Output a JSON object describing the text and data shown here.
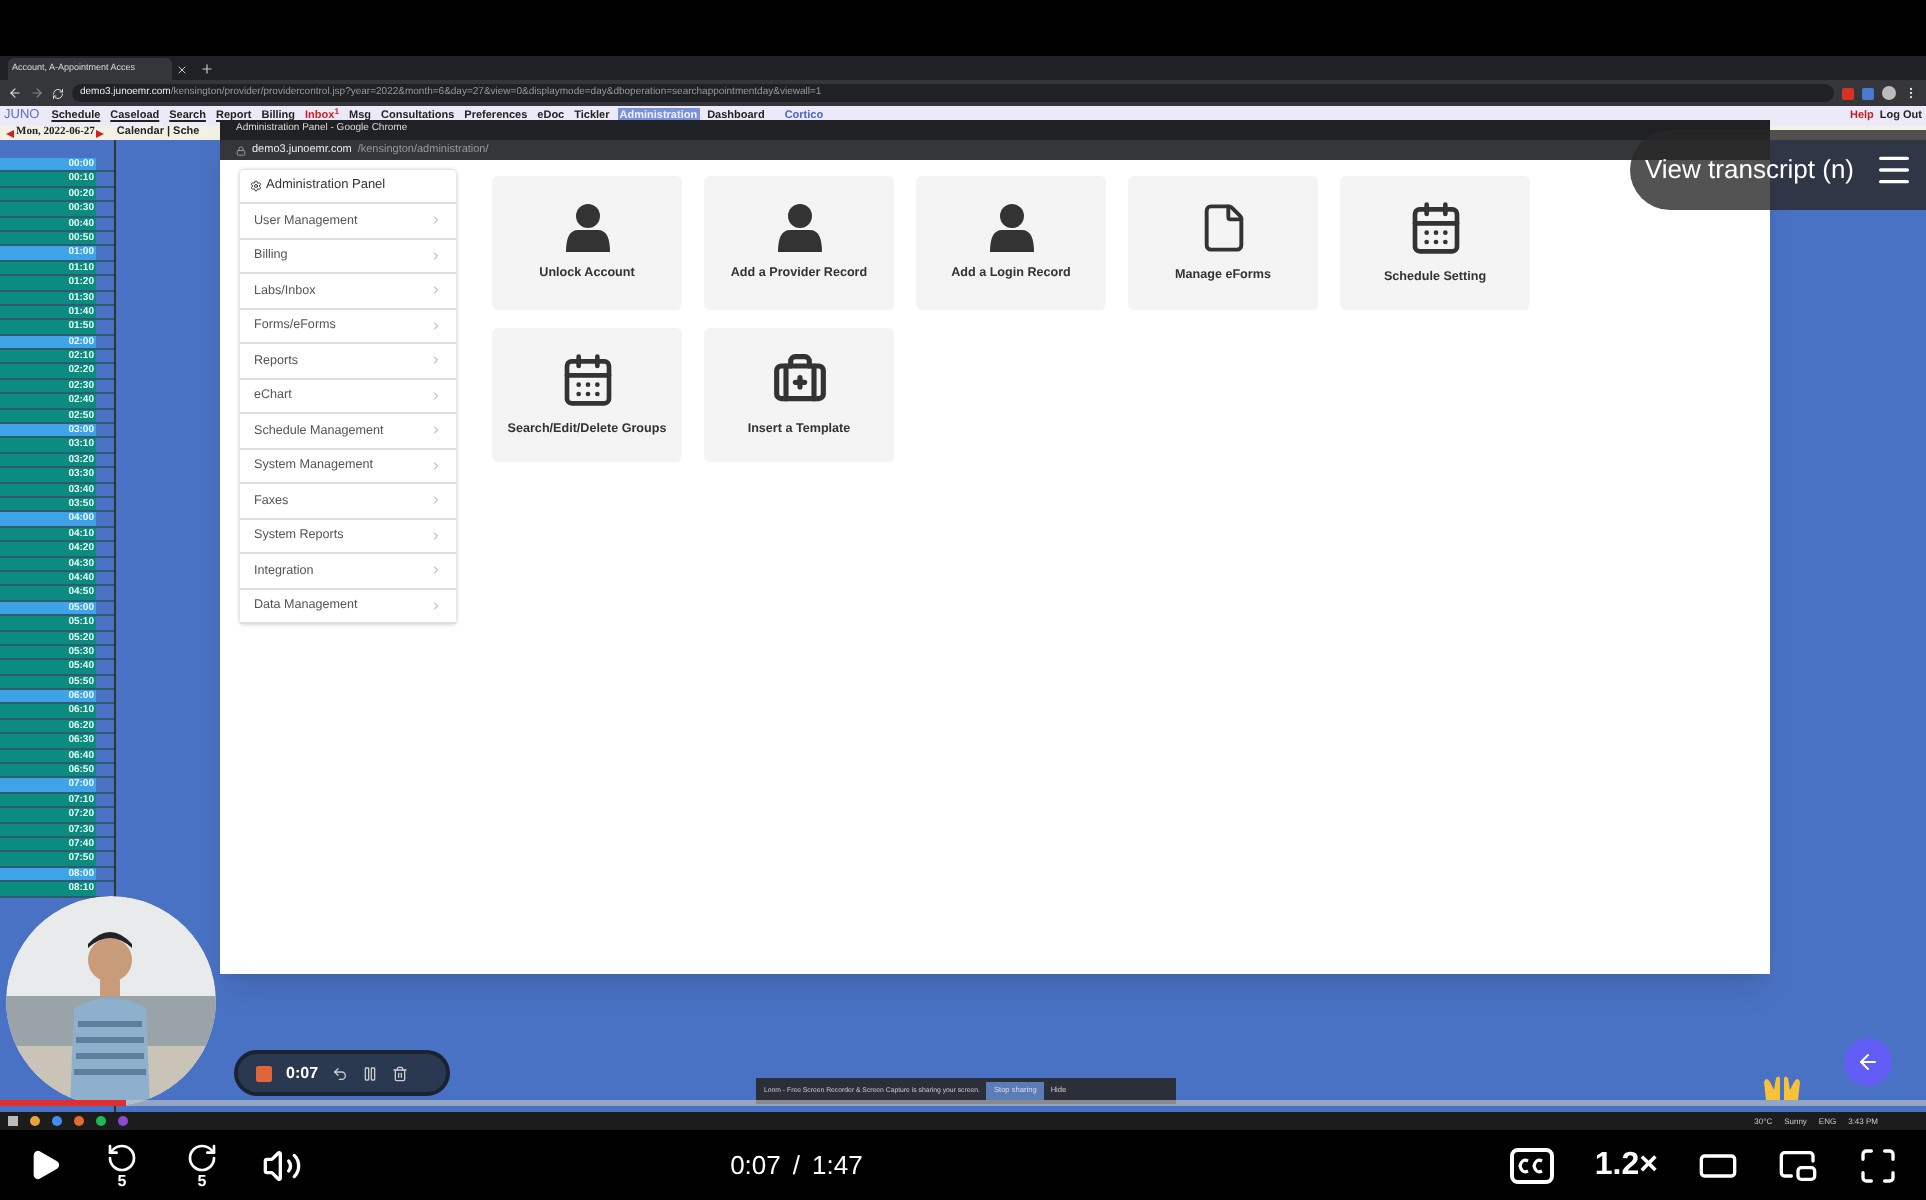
{
  "browser": {
    "tab_title": "Account, A-Appointment Acces",
    "url_host": "demo3.junoemr.com",
    "url_path": "/kensington/provider/providercontrol.jsp?year=2022&month=6&day=27&view=0&displaymode=day&dboperation=searchappointmentday&viewall=1"
  },
  "emr_menu": {
    "logo": "JUNO",
    "items": [
      {
        "label": "Schedule",
        "selected": false
      },
      {
        "label": "Caseload",
        "selected": false
      },
      {
        "label": "Search",
        "selected": false
      },
      {
        "label": "Report",
        "selected": false
      },
      {
        "label": "Billing",
        "selected": false
      },
      {
        "label": "Inbox",
        "selected": false,
        "badge": "1"
      },
      {
        "label": "Msg",
        "selected": false
      },
      {
        "label": "Consultations",
        "selected": false
      },
      {
        "label": "Preferences",
        "selected": false
      },
      {
        "label": "eDoc",
        "selected": false
      },
      {
        "label": "Tickler",
        "selected": false
      },
      {
        "label": "Administration",
        "selected": true
      },
      {
        "label": "Dashboard",
        "selected": false
      }
    ],
    "extension": "Cortico",
    "help": "Help",
    "logout": "Log Out"
  },
  "date_row": {
    "date": "Mon, 2022-06-27",
    "links": "Calendar | Sche"
  },
  "time_slots": [
    {
      "time": "00:00",
      "hour": true
    },
    {
      "time": "00:10",
      "hour": false
    },
    {
      "time": "00:20",
      "hour": false
    },
    {
      "time": "00:30",
      "hour": false
    },
    {
      "time": "00:40",
      "hour": false
    },
    {
      "time": "00:50",
      "hour": false
    },
    {
      "time": "01:00",
      "hour": true
    },
    {
      "time": "01:10",
      "hour": false
    },
    {
      "time": "01:20",
      "hour": false
    },
    {
      "time": "01:30",
      "hour": false
    },
    {
      "time": "01:40",
      "hour": false
    },
    {
      "time": "01:50",
      "hour": false
    },
    {
      "time": "02:00",
      "hour": true
    },
    {
      "time": "02:10",
      "hour": false
    },
    {
      "time": "02:20",
      "hour": false
    },
    {
      "time": "02:30",
      "hour": false
    },
    {
      "time": "02:40",
      "hour": false
    },
    {
      "time": "02:50",
      "hour": false
    },
    {
      "time": "03:00",
      "hour": true
    },
    {
      "time": "03:10",
      "hour": false
    },
    {
      "time": "03:20",
      "hour": false
    },
    {
      "time": "03:30",
      "hour": false
    },
    {
      "time": "03:40",
      "hour": false
    },
    {
      "time": "03:50",
      "hour": false
    },
    {
      "time": "04:00",
      "hour": true
    },
    {
      "time": "04:10",
      "hour": false
    },
    {
      "time": "04:20",
      "hour": false
    },
    {
      "time": "04:30",
      "hour": false
    },
    {
      "time": "04:40",
      "hour": false
    },
    {
      "time": "04:50",
      "hour": false
    },
    {
      "time": "05:00",
      "hour": true
    },
    {
      "time": "05:10",
      "hour": false
    },
    {
      "time": "05:20",
      "hour": false
    },
    {
      "time": "05:30",
      "hour": false
    },
    {
      "time": "05:40",
      "hour": false
    },
    {
      "time": "05:50",
      "hour": false
    },
    {
      "time": "06:00",
      "hour": true
    },
    {
      "time": "06:10",
      "hour": false
    },
    {
      "time": "06:20",
      "hour": false
    },
    {
      "time": "06:30",
      "hour": false
    },
    {
      "time": "06:40",
      "hour": false
    },
    {
      "time": "06:50",
      "hour": false
    },
    {
      "time": "07:00",
      "hour": true
    },
    {
      "time": "07:10",
      "hour": false
    },
    {
      "time": "07:20",
      "hour": false
    },
    {
      "time": "07:30",
      "hour": false
    },
    {
      "time": "07:40",
      "hour": false
    },
    {
      "time": "07:50",
      "hour": false
    },
    {
      "time": "08:00",
      "hour": true
    },
    {
      "time": "08:10",
      "hour": false
    }
  ],
  "popup": {
    "title": "Administration Panel - Google Chrome",
    "url_host": "demo3.junoemr.com",
    "url_path": "/kensington/administration/",
    "panel_title": "Administration Panel",
    "menu": [
      "User Management",
      "Billing",
      "Labs/Inbox",
      "Forms/eForms",
      "Reports",
      "eChart",
      "Schedule Management",
      "System Management",
      "Faxes",
      "System Reports",
      "Integration",
      "Data Management"
    ],
    "tiles": [
      {
        "label": "Unlock Account",
        "kind": "user"
      },
      {
        "label": "Add a Provider Record",
        "kind": "user"
      },
      {
        "label": "Add a Login Record",
        "kind": "user"
      },
      {
        "label": "Manage eForms",
        "kind": "file"
      },
      {
        "label": "Schedule Setting",
        "kind": "calendar"
      },
      {
        "label": "Search/Edit/Delete Groups",
        "kind": "calendar"
      },
      {
        "label": "Insert a Template",
        "kind": "medkit"
      }
    ]
  },
  "loom": {
    "timer": "0:07",
    "notice": "Loom - Free Screen Recorder & Screen Capture is sharing your screen.",
    "stop": "Stop sharing",
    "hide": "Hide"
  },
  "taskbar": {
    "weather": "30°C",
    "condition": "Sunny",
    "lang": "ENG",
    "time": "3:43 PM"
  },
  "overlay": {
    "transcript": "View transcript (n)"
  },
  "player": {
    "current": "0:07",
    "separator": "/",
    "duration": "1:47",
    "level": 0.065,
    "skip_back": "5",
    "skip_forward": "5",
    "speed": "1.2×"
  }
}
